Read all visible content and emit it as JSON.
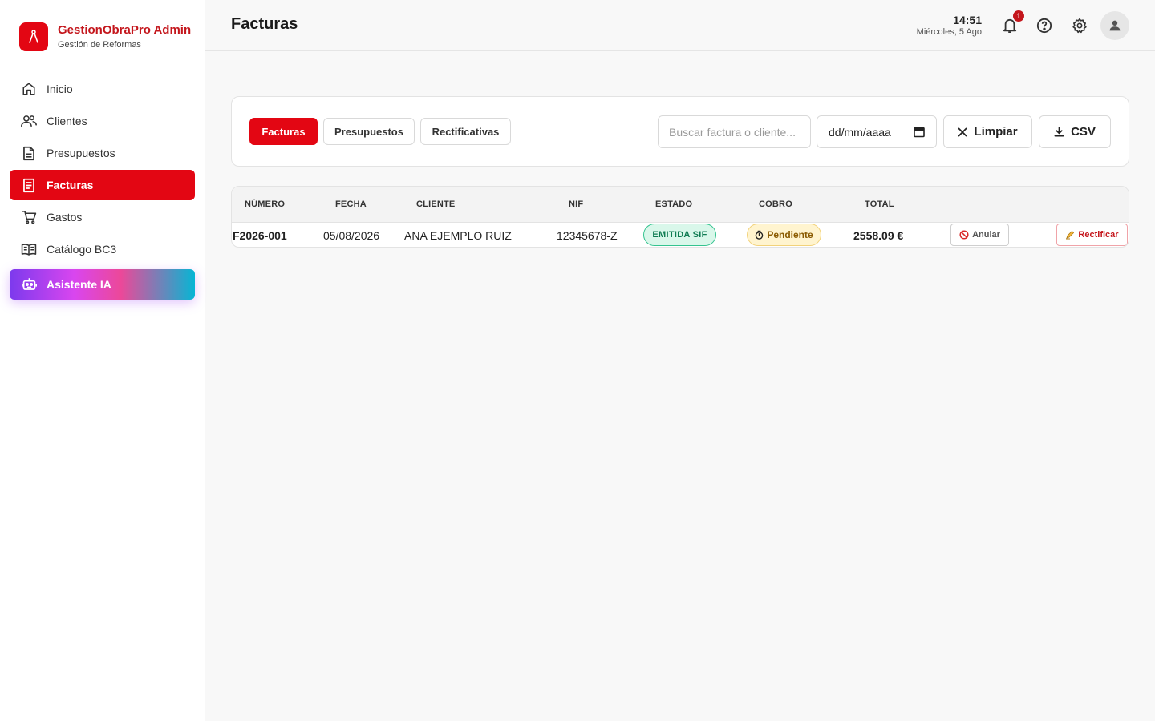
{
  "brand": {
    "title": "GestionObraPro Admin",
    "subtitle": "Gestión de Reformas",
    "logo_icon": "compass-icon",
    "accent_color": "#e30613"
  },
  "sidebar": {
    "items": [
      {
        "label": "Inicio",
        "icon": "home-icon",
        "active": false
      },
      {
        "label": "Clientes",
        "icon": "users-icon",
        "active": false
      },
      {
        "label": "Presupuestos",
        "icon": "document-icon",
        "active": false
      },
      {
        "label": "Facturas",
        "icon": "receipt-icon",
        "active": true
      },
      {
        "label": "Gastos",
        "icon": "cart-icon",
        "active": false
      },
      {
        "label": "Catálogo BC3",
        "icon": "book-icon",
        "active": false
      }
    ],
    "ai_button": {
      "label": "Asistente IA",
      "icon": "robot-icon"
    }
  },
  "header": {
    "title": "Facturas",
    "time": "14:51",
    "date": "Miércoles, 5 Ago",
    "notification_count": "1",
    "icons": [
      "bell-icon",
      "help-icon",
      "gear-icon",
      "avatar-icon"
    ]
  },
  "filters": {
    "tabs": [
      {
        "label": "Facturas",
        "active": true
      },
      {
        "label": "Presupuestos",
        "active": false
      },
      {
        "label": "Rectificativas",
        "active": false
      }
    ],
    "search_placeholder": "Buscar factura o cliente...",
    "date_placeholder": "dd/mm/aaaa",
    "clear_label": "Limpiar",
    "csv_label": "CSV"
  },
  "table": {
    "columns": [
      "NÚMERO",
      "FECHA",
      "CLIENTE",
      "NIF",
      "ESTADO",
      "COBRO",
      "TOTAL"
    ],
    "rows": [
      {
        "numero": "F2026-001",
        "fecha": "05/08/2026",
        "cliente": "ANA EJEMPLO RUIZ",
        "nif": "12345678-Z",
        "estado": "EMITIDA SIF",
        "cobro": "Pendiente",
        "total": "2558.09 €",
        "actions": {
          "anular": "Anular",
          "rectificar": "Rectificar"
        }
      }
    ]
  }
}
